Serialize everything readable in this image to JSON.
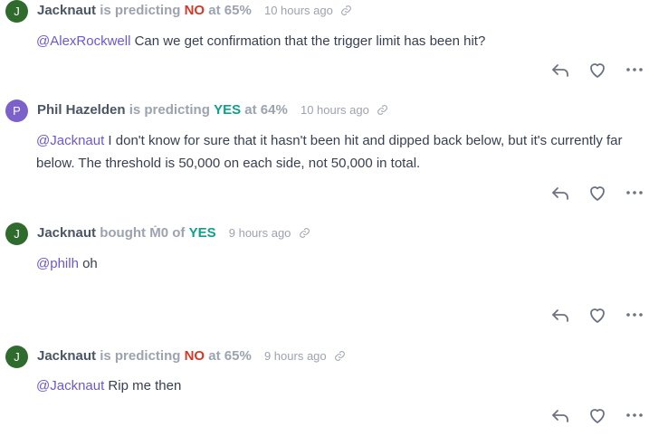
{
  "comments": [
    {
      "avatar_letter": "J",
      "avatar_color": "#2f6b2c",
      "author": "Jacknaut",
      "verb": "is predicting",
      "outcome": "NO",
      "middle": "at",
      "value": "65%",
      "time": "10 hours ago",
      "mention": "@AlexRockwell",
      "text": " Can we get confirmation that the trigger limit has been hit?"
    },
    {
      "avatar_letter": "P",
      "avatar_color": "#7b61c9",
      "author": "Phil Hazelden",
      "verb": "is predicting",
      "outcome": "YES",
      "middle": "at",
      "value": "64%",
      "time": "10 hours ago",
      "mention": "@Jacknaut",
      "text": " I don't know for sure that it hasn't been hit and dipped back below, but it's currently far below. The threshold is 50,000 on each side, not 50,000 in total."
    },
    {
      "avatar_letter": "J",
      "avatar_color": "#2f6b2c",
      "author": "Jacknaut",
      "verb": "bought",
      "amount": "Ṁ0",
      "middle": "of",
      "outcome": "YES",
      "time": "9 hours ago",
      "mention": "@philh",
      "text": " oh"
    },
    {
      "avatar_letter": "J",
      "avatar_color": "#2f6b2c",
      "author": "Jacknaut",
      "verb": "is predicting",
      "outcome": "NO",
      "middle": "at",
      "value": "65%",
      "time": "9 hours ago",
      "mention": "@Jacknaut",
      "text": " Rip me then"
    }
  ],
  "icons": {
    "reply": "reply-icon",
    "like": "heart-icon",
    "more": "more-dots-icon",
    "link": "link-icon"
  }
}
